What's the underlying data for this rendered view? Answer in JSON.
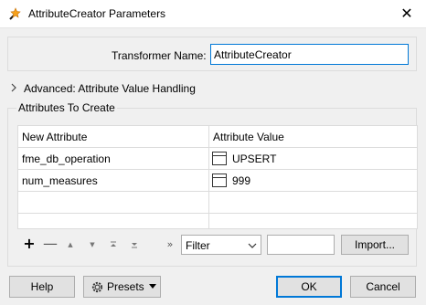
{
  "window": {
    "title": "AttributeCreator Parameters",
    "close_glyph": "✕",
    "icon": "transformer-app-icon"
  },
  "transformer_name": {
    "label": "Transformer Name:",
    "value": "AttributeCreator"
  },
  "advanced": {
    "label": "Advanced: Attribute Value Handling",
    "icon": "chevron-right-icon"
  },
  "attributes_group": {
    "title": "Attributes To Create",
    "columns": [
      "New Attribute",
      "Attribute Value"
    ],
    "rows": [
      {
        "name": "fme_db_operation",
        "value": "UPSERT",
        "value_icon": "value-editor-icon"
      },
      {
        "name": "num_measures",
        "value": "999",
        "value_icon": "value-editor-icon"
      }
    ]
  },
  "toolbar": {
    "add_glyph": "+",
    "remove_glyph": "—",
    "move_top_glyph": "▲",
    "move_up_glyph": "▼",
    "move_bottom_glyph": "≡",
    "more_glyph": "»",
    "filter_selected": "Filter",
    "filter_value": "",
    "import_label": "Import..."
  },
  "footer": {
    "help_label": "Help",
    "presets_label": "Presets",
    "ok_label": "OK",
    "cancel_label": "Cancel"
  },
  "colors": {
    "accent": "#0078d7",
    "background": "#f0f0f0",
    "button": "#e1e1e1"
  }
}
